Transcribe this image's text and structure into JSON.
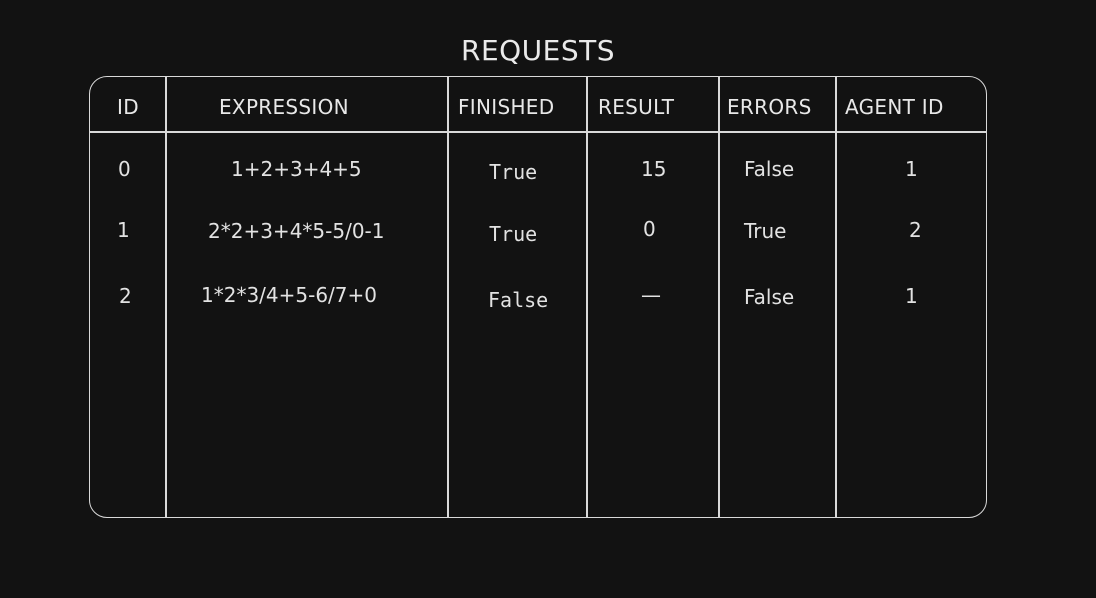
{
  "title": "REQUESTS",
  "columns": [
    "ID",
    "EXPRESSION",
    "FINISHED",
    "RESULT",
    "ERRORS",
    "AGENT ID"
  ],
  "rows": [
    {
      "id": "0",
      "expression": "1+2+3+4+5",
      "finished": "True",
      "result": "15",
      "errors": "False",
      "agent_id": "1"
    },
    {
      "id": "1",
      "expression": "2*2+3+4*5-5/0-1",
      "finished": "True",
      "result": "0",
      "errors": "True",
      "agent_id": "2"
    },
    {
      "id": "2",
      "expression": "1*2*3/4+5-6/7+0",
      "finished": "False",
      "result": "—",
      "errors": "False",
      "agent_id": "1"
    }
  ]
}
